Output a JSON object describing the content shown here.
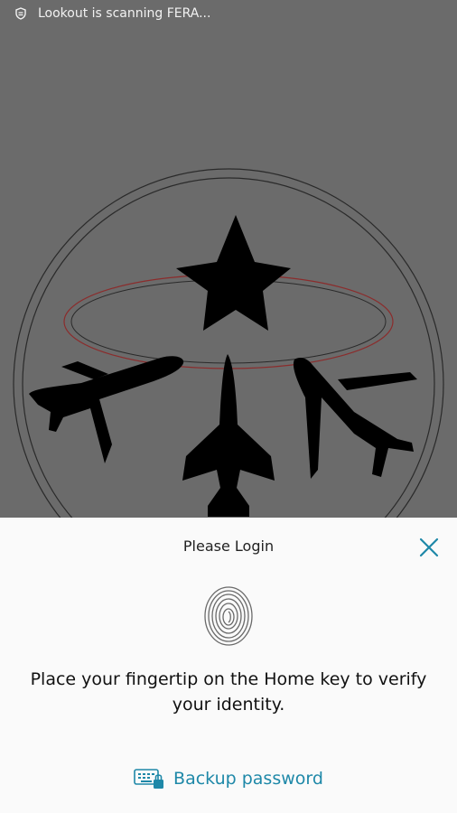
{
  "status_bar": {
    "notification_text": "Lookout is scanning FERA...",
    "icon": "shield-icon"
  },
  "backdrop": {
    "description_icon": "aircraft-emblem-icon"
  },
  "dialog": {
    "title": "Please Login",
    "close_icon": "close-icon",
    "fingerprint_icon": "fingerprint-icon",
    "instruction": "Place your fingertip on the Home key to verify your identity.",
    "backup_label": "Backup password",
    "backup_icon": "keyboard-lock-icon"
  },
  "colors": {
    "backdrop": "#6b6b6b",
    "sheet": "#fafafa",
    "accent": "#1e88a8",
    "emblem_ring_red": "#8b2c2c"
  }
}
